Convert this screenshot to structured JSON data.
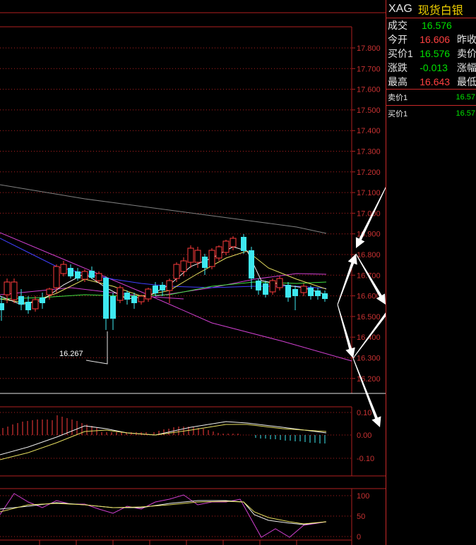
{
  "price_axis": [
    "17.800",
    "17.700",
    "17.600",
    "17.500",
    "17.400",
    "17.300",
    "17.200",
    "17.100",
    "17.000",
    "16.900",
    "16.800",
    "16.700",
    "16.600",
    "16.500",
    "16.400",
    "16.300",
    "16.200"
  ],
  "macd_axis": [
    "0.10",
    "0.00",
    "-0.10"
  ],
  "kdj_axis": [
    "100",
    "50",
    "0"
  ],
  "low_marker": "16.267",
  "quote": {
    "code": "XAG",
    "name": "现货白银",
    "rows": [
      {
        "label": "成交",
        "value": "16.576",
        "value_color": "green",
        "right": ""
      },
      {
        "label": "今开",
        "value": "16.606",
        "value_color": "red",
        "right": "昨收"
      },
      {
        "label": "买价1",
        "value": "16.576",
        "value_color": "green",
        "right": "卖价"
      },
      {
        "label": "涨跌",
        "value": "-0.013",
        "value_color": "green",
        "right": "涨幅"
      },
      {
        "label": "最高",
        "value": "16.643",
        "value_color": "red",
        "right": "最低"
      }
    ],
    "ask1_label": "卖价1",
    "ask1_value": "16.57",
    "bid1_label": "买价1",
    "bid1_value": "16.57"
  },
  "colors": {
    "grid": "#b02020",
    "up": "#ff3b3b",
    "down": "#3ee8f0",
    "ma5": "#f0f0f0",
    "ma10": "#e8e060",
    "ma20": "#40e040",
    "ma60": "#4040ff",
    "ma120": "#d040d0",
    "ma250": "#808080",
    "arrow": "#ffffff"
  }
}
